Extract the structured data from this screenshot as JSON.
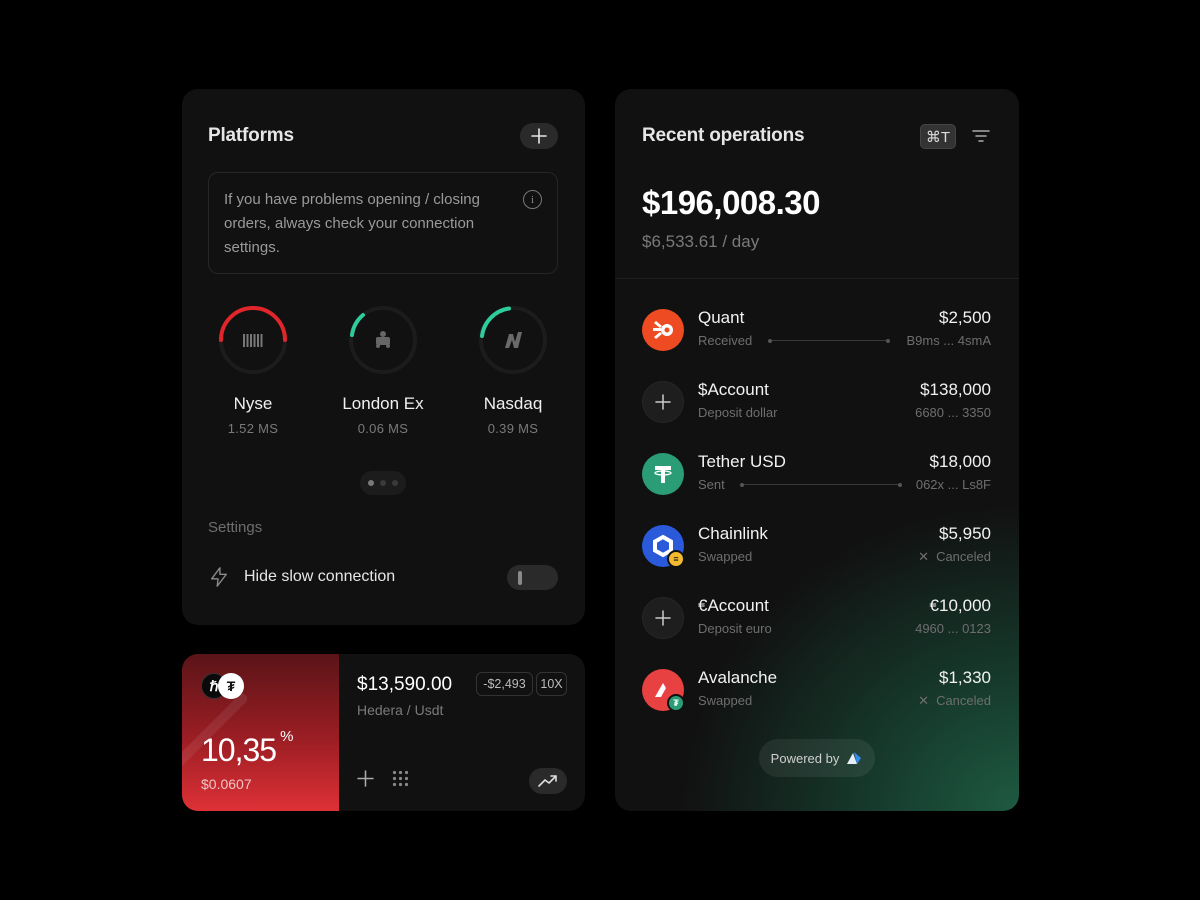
{
  "platforms": {
    "title": "Platforms",
    "add_icon": "plus-icon",
    "info_text": "If you have problems opening / closing orders, always check your connection settings.",
    "info_icon": "info-icon",
    "exchanges": [
      {
        "name": "Nyse",
        "latency": "1.52 MS",
        "icon": "nyse-logo-icon",
        "color": "#e0262b",
        "level": 0.5
      },
      {
        "name": "London Ex",
        "latency": "0.06 MS",
        "icon": "london-exchange-crest-icon",
        "color": "#2ecc9a",
        "level": 0.12
      },
      {
        "name": "Nasdaq",
        "latency": "0.39 MS",
        "icon": "nasdaq-logo-icon",
        "color": "#2ecc9a",
        "level": 0.2
      }
    ],
    "pager": {
      "pages": 3,
      "active": 0
    },
    "settings_label": "Settings",
    "setting": {
      "label": "Hide slow connection",
      "icon": "lightning-icon",
      "enabled": false
    }
  },
  "trade": {
    "coins": [
      "hedera-icon",
      "tether-icon"
    ],
    "percent": "10,35",
    "percent_sign": "%",
    "price": "$0.0607",
    "amount": "$13,590.00",
    "pair": "Hedera / Usdt",
    "pnl": "-$2,493",
    "leverage": "10X",
    "accent": "#de3136"
  },
  "operations": {
    "title": "Recent operations",
    "shortcut": "⌘T",
    "total": "$196,008.30",
    "per_day": "$6,533.61 / day",
    "items": [
      {
        "name": "Quant",
        "sub": "Received",
        "amount": "$2,500",
        "ref": "B9ms ... 4smA",
        "icon": "quant-icon",
        "color": "#ef4b23",
        "arrow": "left"
      },
      {
        "name": "$Account",
        "sub": "Deposit dollar",
        "amount": "$138,000",
        "ref": "6680 ... 3350",
        "icon": "plus-icon"
      },
      {
        "name": "Tether USD",
        "sub": "Sent",
        "amount": "$18,000",
        "ref": "062x ... Ls8F",
        "icon": "tether-icon",
        "color": "#2a9d77",
        "arrow": "right"
      },
      {
        "name": "Chainlink",
        "sub": "Swapped",
        "amount": "$5,950",
        "ref": "Canceled",
        "icon": "chainlink-icon",
        "color": "#2a5ada",
        "badge": "binance-icon",
        "canceled": true
      },
      {
        "name": "€Account",
        "sub": "Deposit euro",
        "amount": "€10,000",
        "ref": "4960 ... 0123",
        "icon": "plus-icon"
      },
      {
        "name": "Avalanche",
        "sub": "Swapped",
        "amount": "$1,330",
        "ref": "Canceled",
        "icon": "avalanche-icon",
        "color": "#e84142",
        "badge": "tether-icon",
        "canceled": true
      }
    ],
    "powered_by": "Powered by"
  }
}
